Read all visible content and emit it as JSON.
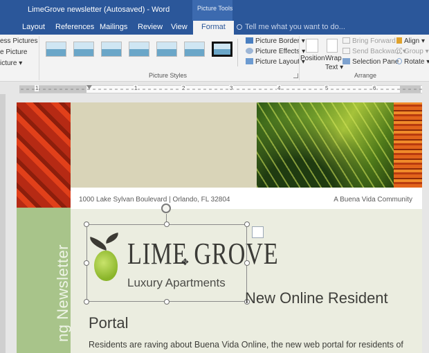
{
  "window": {
    "title": "LimeGrove newsletter (Autosaved) - Word",
    "context_group": "Picture Tools"
  },
  "tabs": [
    {
      "label": "Layout"
    },
    {
      "label": "References"
    },
    {
      "label": "Mailings"
    },
    {
      "label": "Review"
    },
    {
      "label": "View"
    },
    {
      "label": "Format",
      "active": true
    }
  ],
  "tell_me": {
    "placeholder": "Tell me what you want to do..."
  },
  "ribbon": {
    "adjust": [
      "ess Pictures",
      "e Picture",
      "icture"
    ],
    "picture_styles": {
      "group_label": "Picture Styles",
      "selected_index": 6,
      "commands": [
        "Picture Border",
        "Picture Effects",
        "Picture Layout"
      ]
    },
    "arrange": {
      "group_label": "Arrange",
      "position": "Position",
      "wrap_text": [
        "Wrap",
        "Text"
      ],
      "bring_forward": "Bring Forward",
      "send_backward": "Send Backward",
      "selection_pane": "Selection Pane",
      "align": "Align",
      "group": "Group",
      "rotate": "Rotate"
    }
  },
  "ruler": {
    "numbers": [
      "1",
      "1",
      "2",
      "3",
      "4",
      "5",
      "6"
    ]
  },
  "document": {
    "address": "1000 Lake Sylvan Boulevard | Orlando, FL 32804",
    "community": "A Buena Vida Community",
    "logo": {
      "name": "LIME GROVE",
      "subtitle": "Luxury Apartments"
    },
    "vertical_banner": "ng Newsletter",
    "headline_part1": "New Online Resident",
    "headline_part2": "Portal",
    "paragraph": "Residents are raving about Buena Vida Online, the new web portal for residents of"
  },
  "colors": {
    "word_blue": "#2b579a",
    "accent_orange": "#e1401a",
    "lime_green": "#a8c48a"
  }
}
